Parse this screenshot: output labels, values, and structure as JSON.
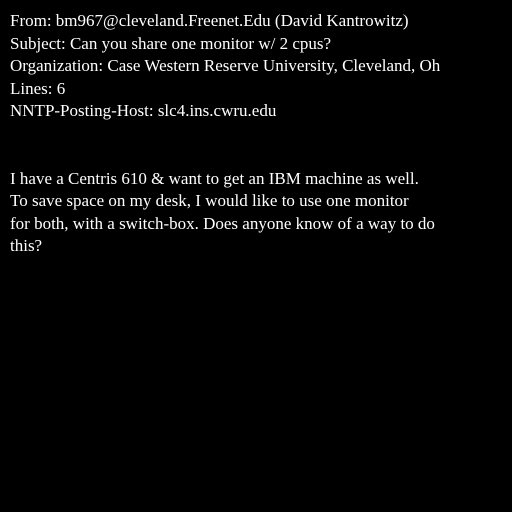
{
  "header": {
    "from": "From: bm967@cleveland.Freenet.Edu (David Kantrowitz)",
    "subject": "Subject: Can you share one monitor w/ 2 cpus?",
    "organization": "Organization: Case Western Reserve University, Cleveland, Oh",
    "lines": "Lines: 6",
    "nntp_posting_host": "NNTP-Posting-Host: slc4.ins.cwru.edu"
  },
  "body": {
    "lines": [
      "I have a Centris 610 & want to get an IBM machine as well.",
      "To save space on my desk, I would like to use one monitor",
      "for both, with a switch-box. Does anyone know of a way to do",
      "this?"
    ]
  },
  "colors": {
    "background": "#000000",
    "text": "#ffffff"
  }
}
